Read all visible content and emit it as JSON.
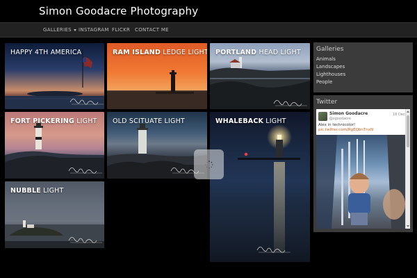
{
  "site": {
    "title": "Simon Goodacre Photography"
  },
  "nav": {
    "items": [
      {
        "label": "GALLERIES",
        "has_caret": true
      },
      {
        "label": "INSTAGRAM"
      },
      {
        "label": "FLICKR"
      },
      {
        "label": "CONTACT ME"
      }
    ]
  },
  "galleries_grid": {
    "tiles": [
      {
        "bold": "",
        "light": "HAPPY 4TH AMERICA"
      },
      {
        "bold": "RAM ISLAND",
        "light": " LEDGE LIGHT"
      },
      {
        "bold": "PORTLAND",
        "light": " HEAD LIGHT"
      },
      {
        "bold": "FORT PICKERING",
        "light": " LIGHT"
      },
      {
        "bold": "",
        "light": "OLD SCITUATE LIGHT"
      },
      {
        "bold": "WHALEBACK",
        "light": " LIGHT"
      },
      {
        "bold": "NUBBLE",
        "light": " LIGHT"
      }
    ]
  },
  "sidebar": {
    "galleries": {
      "title": "Galleries",
      "links": [
        "Animals",
        "Landscapes",
        "Lighthouses",
        "People"
      ]
    },
    "twitter": {
      "title": "Twitter",
      "tweet": {
        "name": "Simon Goodacre",
        "handle": "@sgoodacre",
        "date": "18 Dec",
        "text": "Alex in technicolor!",
        "link": "pic.twitter.com/RgEQbnTnxN"
      }
    }
  },
  "colors": {
    "background": "#000000",
    "navbar": "#222222",
    "panel": "#3b3b3b",
    "link_accent": "#d0601a"
  },
  "icons": {
    "watermark": "signature-watermark",
    "loader": "spinner-icon",
    "caret": "caret-down-icon"
  }
}
